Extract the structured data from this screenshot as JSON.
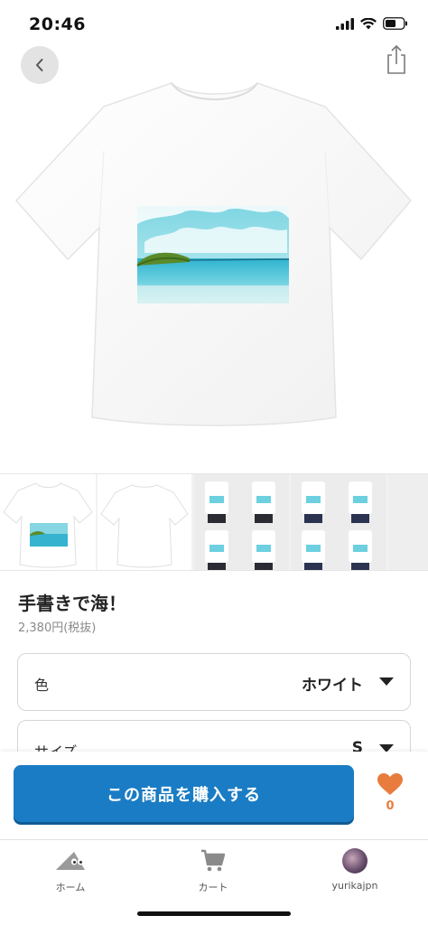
{
  "status_bar": {
    "time": "20:46"
  },
  "product": {
    "title": "手書きで海！",
    "price": "2,380円(税抜)"
  },
  "options": {
    "color": {
      "label": "色",
      "value": "ホワイト"
    },
    "size": {
      "label": "サイズ",
      "value": "S"
    }
  },
  "cta": {
    "buy_label": "この商品を購入する",
    "like_count": "0"
  },
  "tabs": [
    {
      "label": "ホーム",
      "icon": "home-icon"
    },
    {
      "label": "カート",
      "icon": "cart-icon"
    },
    {
      "label": "yurikajpn",
      "icon": "avatar"
    }
  ],
  "colors": {
    "accent": "#1a7cc4",
    "like": "#e87c3e"
  }
}
